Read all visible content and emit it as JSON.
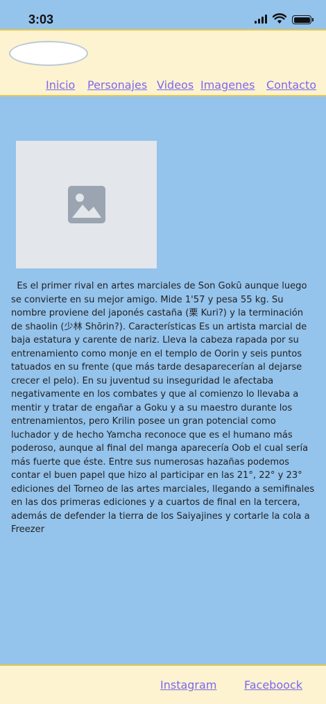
{
  "status_bar": {
    "time": "3:03",
    "signal_icon": "cellular-signal-icon",
    "wifi_icon": "wifi-icon",
    "battery_icon": "battery-icon"
  },
  "header": {
    "logo_icon": "logo-placeholder",
    "nav": [
      {
        "label": "Inicio"
      },
      {
        "label": "Personajes"
      },
      {
        "label": "Videos"
      },
      {
        "label": "Imagenes"
      },
      {
        "label": "Contacto"
      }
    ]
  },
  "main": {
    "image_icon": "image-placeholder-icon",
    "bio": "  Es el primer rival en artes marciales de Son Gokū aunque luego se convierte en su mejor amigo. Mide 1'57 y pesa 55 kg. Su nombre proviene del japonés castaña (栗 Kuri?) y la terminación de shaolin (少林 Shōrin?). Características Es un artista marcial de baja estatura y carente de nariz. Lleva la cabeza rapada por su entrenamiento como monje en el templo de Oorin y seis puntos tatuados en su frente (que más tarde desaparecerían al dejarse crecer el pelo). En su juventud su inseguridad le afectaba negativamente en los combates y que al comienzo lo llevaba a mentir y tratar de engañar a Goku y a su maestro durante los entrenamientos, pero Krilin posee un gran potencial como luchador y de hecho Yamcha reconoce que es el humano más poderoso, aunque al final del manga aparecería Oob el cual sería más fuerte que éste. Entre sus numerosas hazañas podemos contar el buen papel que hizo al participar en las 21°, 22° y 23° ediciones del Torneo de las artes marciales, llegando a semifinales en las dos primeras ediciones y a cuartos de final en la tercera, además de defender la tierra de los Saiyajines y cortarle la cola a Freezer"
  },
  "footer": {
    "links": [
      {
        "label": "Instagram"
      },
      {
        "label": "Faceboock"
      }
    ]
  },
  "colors": {
    "page_bg": "#94c3ec",
    "bar_bg": "#fdf3d0",
    "bar_border": "#e8c64a",
    "link": "#7b68ee"
  }
}
